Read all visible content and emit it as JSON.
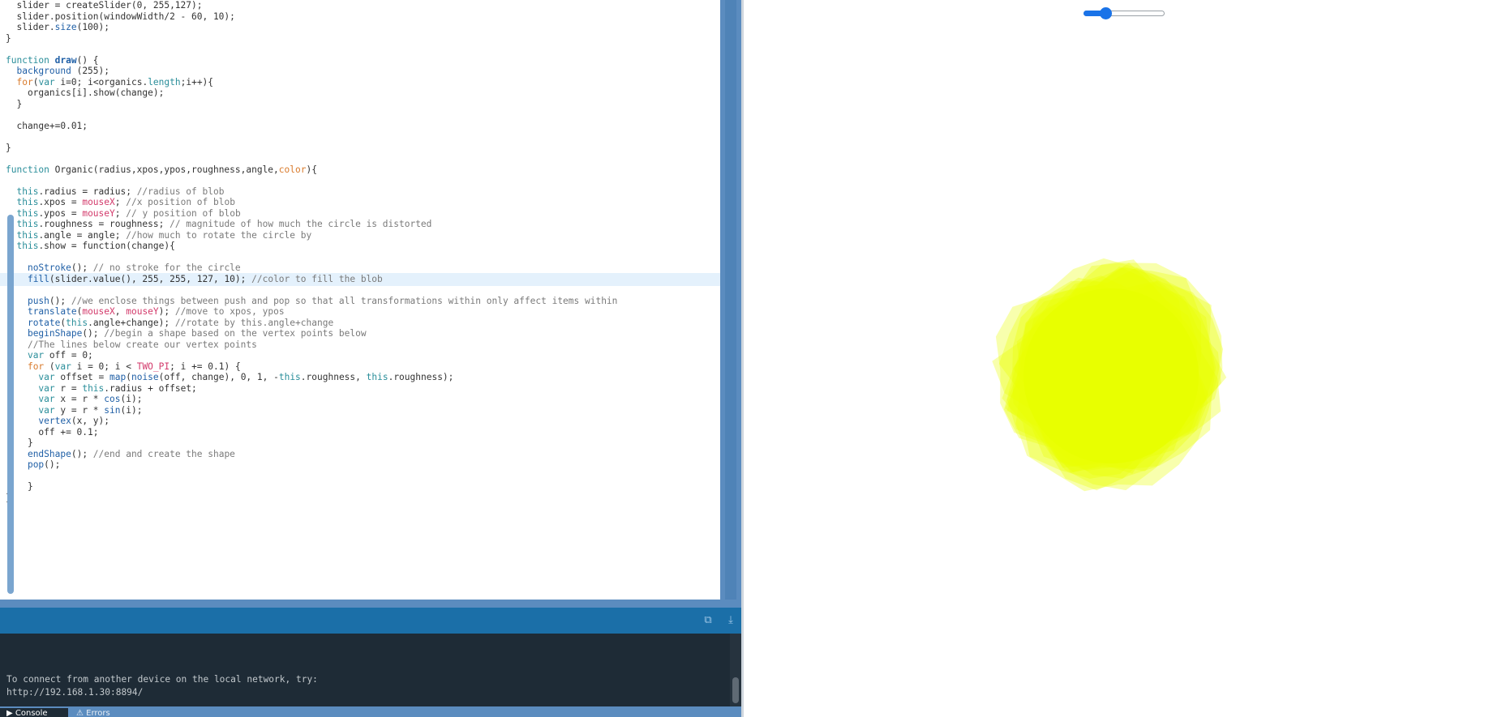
{
  "editor": {
    "lines": [
      [
        [
          "  slider = createSlider(0, 255,127);",
          ""
        ]
      ],
      [
        [
          "  slider.position(windowWidth/2 - 60, 10);",
          ""
        ]
      ],
      [
        [
          "  slider.",
          ""
        ],
        [
          "size",
          "call"
        ],
        [
          "(100);",
          ""
        ]
      ],
      [
        [
          "}",
          ""
        ]
      ],
      [
        [
          "",
          ""
        ]
      ],
      [
        [
          "function ",
          "kw"
        ],
        [
          "draw",
          "fn"
        ],
        [
          "() {",
          ""
        ]
      ],
      [
        [
          "  ",
          ""
        ],
        [
          "background",
          "call"
        ],
        [
          " (255);",
          ""
        ]
      ],
      [
        [
          "  ",
          ""
        ],
        [
          "for",
          "orange"
        ],
        [
          "(",
          ""
        ],
        [
          "var",
          "kw"
        ],
        [
          " i=0; i<organics.",
          ""
        ],
        [
          "length",
          "teal"
        ],
        [
          ";i++){",
          ""
        ]
      ],
      [
        [
          "    organics[i].show(change);",
          ""
        ]
      ],
      [
        [
          "  }",
          ""
        ]
      ],
      [
        [
          "",
          ""
        ]
      ],
      [
        [
          "  change+=0.01;",
          ""
        ]
      ],
      [
        [
          "",
          ""
        ]
      ],
      [
        [
          "}",
          ""
        ]
      ],
      [
        [
          "",
          ""
        ]
      ],
      [
        [
          "function ",
          "kw"
        ],
        [
          "Organic(radius,xpos,ypos,roughness,angle,",
          ""
        ],
        [
          "color",
          "orange"
        ],
        [
          "){",
          ""
        ]
      ],
      [
        [
          "",
          ""
        ]
      ],
      [
        [
          "  ",
          ""
        ],
        [
          "this",
          "kw"
        ],
        [
          ".radius = radius; ",
          ""
        ],
        [
          "//radius of blob",
          "cm"
        ]
      ],
      [
        [
          "  ",
          ""
        ],
        [
          "this",
          "kw"
        ],
        [
          ".xpos = ",
          ""
        ],
        [
          "mouseX",
          "pink"
        ],
        [
          "; ",
          ""
        ],
        [
          "//x position of blob",
          "cm"
        ]
      ],
      [
        [
          "  ",
          ""
        ],
        [
          "this",
          "kw"
        ],
        [
          ".ypos = ",
          ""
        ],
        [
          "mouseY",
          "pink"
        ],
        [
          "; ",
          ""
        ],
        [
          "// y position of blob",
          "cm"
        ]
      ],
      [
        [
          "  ",
          ""
        ],
        [
          "this",
          "kw"
        ],
        [
          ".roughness = roughness; ",
          ""
        ],
        [
          "// magnitude of how much the circle is distorted",
          "cm"
        ]
      ],
      [
        [
          "  ",
          ""
        ],
        [
          "this",
          "kw"
        ],
        [
          ".angle = angle; ",
          ""
        ],
        [
          "//how much to rotate the circle by",
          "cm"
        ]
      ],
      [
        [
          "  ",
          ""
        ],
        [
          "this",
          "kw"
        ],
        [
          ".show = function(change){",
          ""
        ]
      ],
      [
        [
          "",
          ""
        ]
      ],
      [
        [
          "    ",
          ""
        ],
        [
          "noStroke",
          "call"
        ],
        [
          "(); ",
          ""
        ],
        [
          "// no stroke for the circle",
          "cm"
        ]
      ],
      [
        [
          "    ",
          ""
        ],
        [
          "fill",
          "call"
        ],
        [
          "(slider.value(), 255, 255, 127, 10); ",
          ""
        ],
        [
          "//color to fill the blob",
          "cm"
        ]
      ],
      [
        [
          "",
          ""
        ]
      ],
      [
        [
          "    ",
          ""
        ],
        [
          "push",
          "call"
        ],
        [
          "(); ",
          ""
        ],
        [
          "//we enclose things between push and pop so that all transformations within only affect items within",
          "cm"
        ]
      ],
      [
        [
          "    ",
          ""
        ],
        [
          "translate",
          "call"
        ],
        [
          "(",
          ""
        ],
        [
          "mouseX",
          "pink"
        ],
        [
          ", ",
          ""
        ],
        [
          "mouseY",
          "pink"
        ],
        [
          "); ",
          ""
        ],
        [
          "//move to xpos, ypos",
          "cm"
        ]
      ],
      [
        [
          "    ",
          ""
        ],
        [
          "rotate",
          "call"
        ],
        [
          "(",
          ""
        ],
        [
          "this",
          "kw"
        ],
        [
          ".angle+change); ",
          ""
        ],
        [
          "//rotate by this.angle+change",
          "cm"
        ]
      ],
      [
        [
          "    ",
          ""
        ],
        [
          "beginShape",
          "call"
        ],
        [
          "(); ",
          ""
        ],
        [
          "//begin a shape based on the vertex points below",
          "cm"
        ]
      ],
      [
        [
          "    ",
          ""
        ],
        [
          "//The lines below create our vertex points",
          "cm"
        ]
      ],
      [
        [
          "    ",
          ""
        ],
        [
          "var",
          "kw"
        ],
        [
          " off = 0;",
          ""
        ]
      ],
      [
        [
          "    ",
          ""
        ],
        [
          "for",
          "orange"
        ],
        [
          " (",
          ""
        ],
        [
          "var",
          "kw"
        ],
        [
          " i = 0; i < ",
          ""
        ],
        [
          "TWO_PI",
          "pink"
        ],
        [
          "; i += 0.1) {",
          ""
        ]
      ],
      [
        [
          "      ",
          ""
        ],
        [
          "var",
          "kw"
        ],
        [
          " offset = ",
          ""
        ],
        [
          "map",
          "call"
        ],
        [
          "(",
          ""
        ],
        [
          "noise",
          "call"
        ],
        [
          "(off, change), 0, 1, -",
          ""
        ],
        [
          "this",
          "kw"
        ],
        [
          ".roughness, ",
          ""
        ],
        [
          "this",
          "kw"
        ],
        [
          ".roughness);",
          ""
        ]
      ],
      [
        [
          "      ",
          ""
        ],
        [
          "var",
          "kw"
        ],
        [
          " r = ",
          ""
        ],
        [
          "this",
          "kw"
        ],
        [
          ".radius + offset;",
          ""
        ]
      ],
      [
        [
          "      ",
          ""
        ],
        [
          "var",
          "kw"
        ],
        [
          " x = r * ",
          ""
        ],
        [
          "cos",
          "call"
        ],
        [
          "(i);",
          ""
        ]
      ],
      [
        [
          "      ",
          ""
        ],
        [
          "var",
          "kw"
        ],
        [
          " y = r * ",
          ""
        ],
        [
          "sin",
          "call"
        ],
        [
          "(i);",
          ""
        ]
      ],
      [
        [
          "      ",
          ""
        ],
        [
          "vertex",
          "call"
        ],
        [
          "(x, y);",
          ""
        ]
      ],
      [
        [
          "      off += 0.1;",
          ""
        ]
      ],
      [
        [
          "    }",
          ""
        ]
      ],
      [
        [
          "    ",
          ""
        ],
        [
          "endShape",
          "call"
        ],
        [
          "(); ",
          ""
        ],
        [
          "//end and create the shape",
          "cm"
        ]
      ],
      [
        [
          "    ",
          ""
        ],
        [
          "pop",
          "call"
        ],
        [
          "();",
          ""
        ]
      ],
      [
        [
          "",
          ""
        ]
      ],
      [
        [
          "    }",
          ""
        ]
      ],
      [
        [
          "}",
          ""
        ]
      ]
    ],
    "highlighted_line": 25
  },
  "console": {
    "lines": [
      "To connect from another device on the local network, try:",
      "http://192.168.1.30:8894/"
    ],
    "tabs": {
      "console": "Console",
      "errors": "Errors"
    }
  },
  "preview": {
    "slider_min": 0,
    "slider_max": 255,
    "slider_value": 60,
    "blob_color": "#e8ff00"
  },
  "colors": {
    "accent": "#1b6fa8",
    "console_bg": "#1e2b36"
  }
}
